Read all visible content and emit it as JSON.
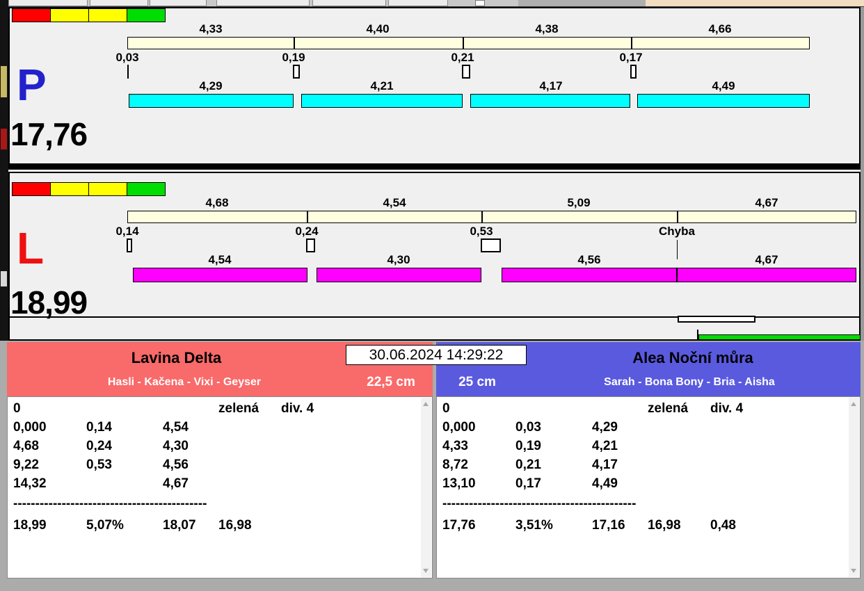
{
  "traffic_light_colors": [
    "#FF0000",
    "#FFFF00",
    "#FFFF00",
    "#00DD00"
  ],
  "datetime": "30.06.2024 14:29:22",
  "accent_green": "#00DD00",
  "lanes": [
    {
      "id": "P",
      "letter": "P",
      "letter_color": "#2222CC",
      "bar_color": "#00FFFF",
      "total": "17,76",
      "legs": [
        {
          "label": "4,33",
          "value": 4.33
        },
        {
          "label": "4,40",
          "value": 4.4
        },
        {
          "label": "4,38",
          "value": 4.38
        },
        {
          "label": "4,66",
          "value": 4.66
        }
      ],
      "boxes": [
        {
          "label": "0,03",
          "value": 0.03
        },
        {
          "label": "0,19",
          "value": 0.19
        },
        {
          "label": "0,21",
          "value": 0.21
        },
        {
          "label": "0,17",
          "value": 0.17
        }
      ],
      "dogs": [
        {
          "label": "4,29",
          "value": 4.29
        },
        {
          "label": "4,21",
          "value": 4.21
        },
        {
          "label": "4,17",
          "value": 4.17
        },
        {
          "label": "4,49",
          "value": 4.49
        }
      ]
    },
    {
      "id": "L",
      "letter": "L",
      "letter_color": "#EE1111",
      "bar_color": "#FF00FF",
      "total": "18,99",
      "legs": [
        {
          "label": "4,68",
          "value": 4.68
        },
        {
          "label": "4,54",
          "value": 4.54
        },
        {
          "label": "5,09",
          "value": 5.09
        },
        {
          "label": "4,67",
          "value": 4.67
        }
      ],
      "boxes": [
        {
          "label": "0,14",
          "value": 0.14
        },
        {
          "label": "0,24",
          "value": 0.24
        },
        {
          "label": "0,53",
          "value": 0.53
        },
        {
          "label": "Chyba",
          "value": null
        }
      ],
      "dogs": [
        {
          "label": "4,54",
          "value": 4.54
        },
        {
          "label": "4,30",
          "value": 4.3
        },
        {
          "label": "4,56",
          "value": 4.56
        },
        {
          "label": "4,67",
          "value": 4.67
        }
      ]
    }
  ],
  "teams": {
    "left": {
      "name": "Lavina Delta",
      "members": "Hasli - Kačena - Vixi - Geyser",
      "jump_height": "22,5 cm",
      "color": "#F96A6A"
    },
    "right": {
      "name": "Alea Noční můra",
      "members": "Sarah - Bona Bony - Bria - Aisha",
      "jump_height": "25 cm",
      "color": "#5A5ADF"
    }
  },
  "results": {
    "left": {
      "rows": [
        [
          "0",
          "",
          "",
          "zelená",
          "div. 4"
        ],
        [
          "0,000",
          "0,14",
          "4,54",
          "",
          ""
        ],
        [
          "4,68",
          "0,24",
          "4,30",
          "",
          ""
        ],
        [
          "9,22",
          "0,53",
          "4,56",
          "",
          ""
        ],
        [
          "14,32",
          "",
          "4,67",
          "",
          ""
        ]
      ],
      "separator": "--------------------------------------------",
      "summary": [
        "18,99",
        "5,07%",
        "18,07",
        "16,98",
        ""
      ]
    },
    "right": {
      "rows": [
        [
          "0",
          "",
          "",
          "zelená",
          "div. 4"
        ],
        [
          "0,000",
          "0,03",
          "4,29",
          "",
          ""
        ],
        [
          "4,33",
          "0,19",
          "4,21",
          "",
          ""
        ],
        [
          "8,72",
          "0,21",
          "4,17",
          "",
          ""
        ],
        [
          "13,10",
          "0,17",
          "4,49",
          "",
          ""
        ]
      ],
      "separator": "--------------------------------------------",
      "summary": [
        "17,76",
        "3,51%",
        "17,16",
        "16,98",
        "0,48"
      ]
    }
  }
}
